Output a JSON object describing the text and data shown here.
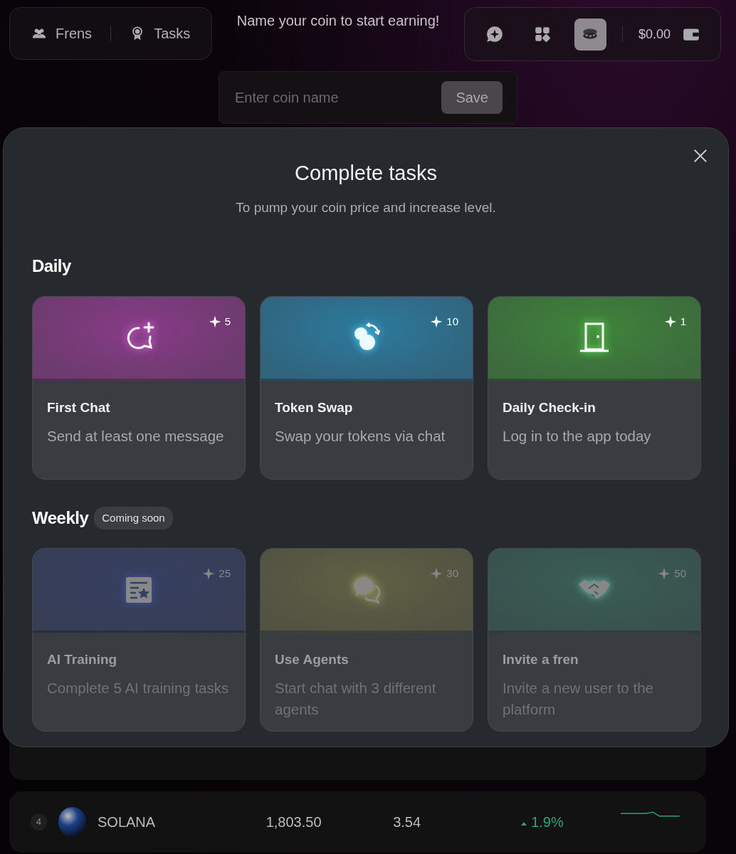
{
  "header": {
    "nav": [
      {
        "label": "Frens"
      },
      {
        "label": "Tasks"
      }
    ],
    "prompt": "Name your coin to start earning!",
    "toolbar": [
      {
        "selected": false
      },
      {
        "selected": false
      },
      {
        "selected": true
      }
    ],
    "balance": "$0.00"
  },
  "coin_form": {
    "placeholder": "Enter coin name",
    "button": "Save"
  },
  "leaderboard": [
    {
      "rank": "4",
      "name": "SOLANA",
      "price": "1,803.50",
      "value": "3.54",
      "change": "1.9%"
    }
  ],
  "modal": {
    "title": "Complete tasks",
    "subtitle": "To pump your coin price and increase level.",
    "sections": [
      {
        "title": "Daily",
        "tasks": [
          {
            "title": "First Chat",
            "description": "Send at least one message",
            "points": "5",
            "disabled": false
          },
          {
            "title": "Token Swap",
            "description": "Swap your tokens via chat",
            "points": "10",
            "disabled": false
          },
          {
            "title": "Daily Check-in",
            "description": "Log in to the app today",
            "points": "1",
            "disabled": false
          }
        ]
      },
      {
        "title": "Weekly",
        "badge": "Coming soon",
        "tasks": [
          {
            "title": "AI Training",
            "description": "Complete 5 AI training tasks",
            "points": "25",
            "disabled": true
          },
          {
            "title": "Use Agents",
            "description": "Start chat with 3 different agents",
            "points": "30",
            "disabled": true
          },
          {
            "title": "Invite a fren",
            "description": "Invite a new user to the platform",
            "points": "50",
            "disabled": true
          }
        ]
      }
    ]
  }
}
